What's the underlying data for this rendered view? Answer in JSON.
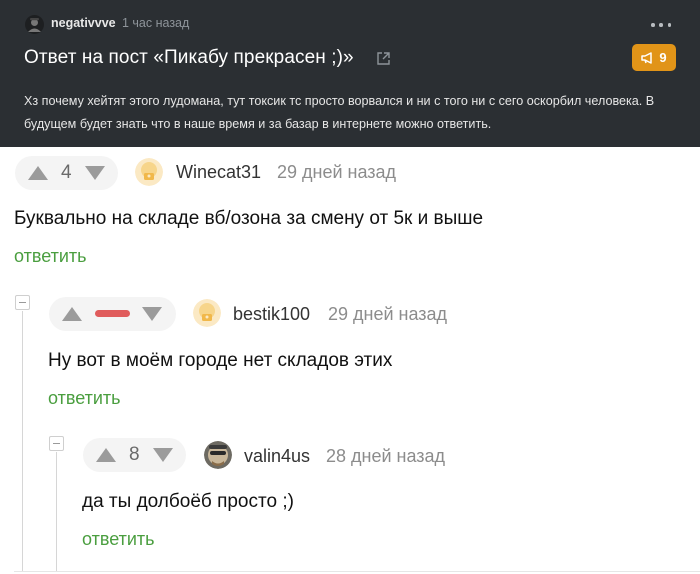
{
  "post": {
    "author": "negativvve",
    "time": "1 час назад",
    "title": "Ответ на пост «Пикабу прекрасен ;)»",
    "badge_count": "9",
    "body": "Хз почему хейтят этого лудомана, тут токсик тс просто ворвался и ни с того ни с сего оскорбил человека. В будущем будет знать что в наше время и за базар в интернете можно ответить."
  },
  "comments": [
    {
      "rating": "4",
      "username": "Winecat31",
      "time": "29 дней назад",
      "text": "Буквально на складе вб/озона за смену от 5к и выше",
      "reply_label": "ответить"
    },
    {
      "rating": "",
      "rating_state": "hidden",
      "username": "bestik100",
      "time": "29 дней назад",
      "text": "Ну вот в моём городе нет складов этих",
      "reply_label": "ответить"
    },
    {
      "rating": "8",
      "username": "valin4us",
      "time": "28 дней назад",
      "text": "да ты долбоёб просто ;)",
      "reply_label": "ответить"
    }
  ],
  "colors": {
    "header_bg": "#2b2f33",
    "badge": "#e19418",
    "reply_link": "#4a9e3f",
    "hidden_rating": "#e05c5c"
  },
  "icons": {
    "more": "more-dots-icon",
    "external": "external-link-icon",
    "badge": "megaphone-icon",
    "upvote": "upvote-arrow-icon",
    "downvote": "downvote-arrow-icon",
    "collapse": "collapse-thread-icon"
  }
}
